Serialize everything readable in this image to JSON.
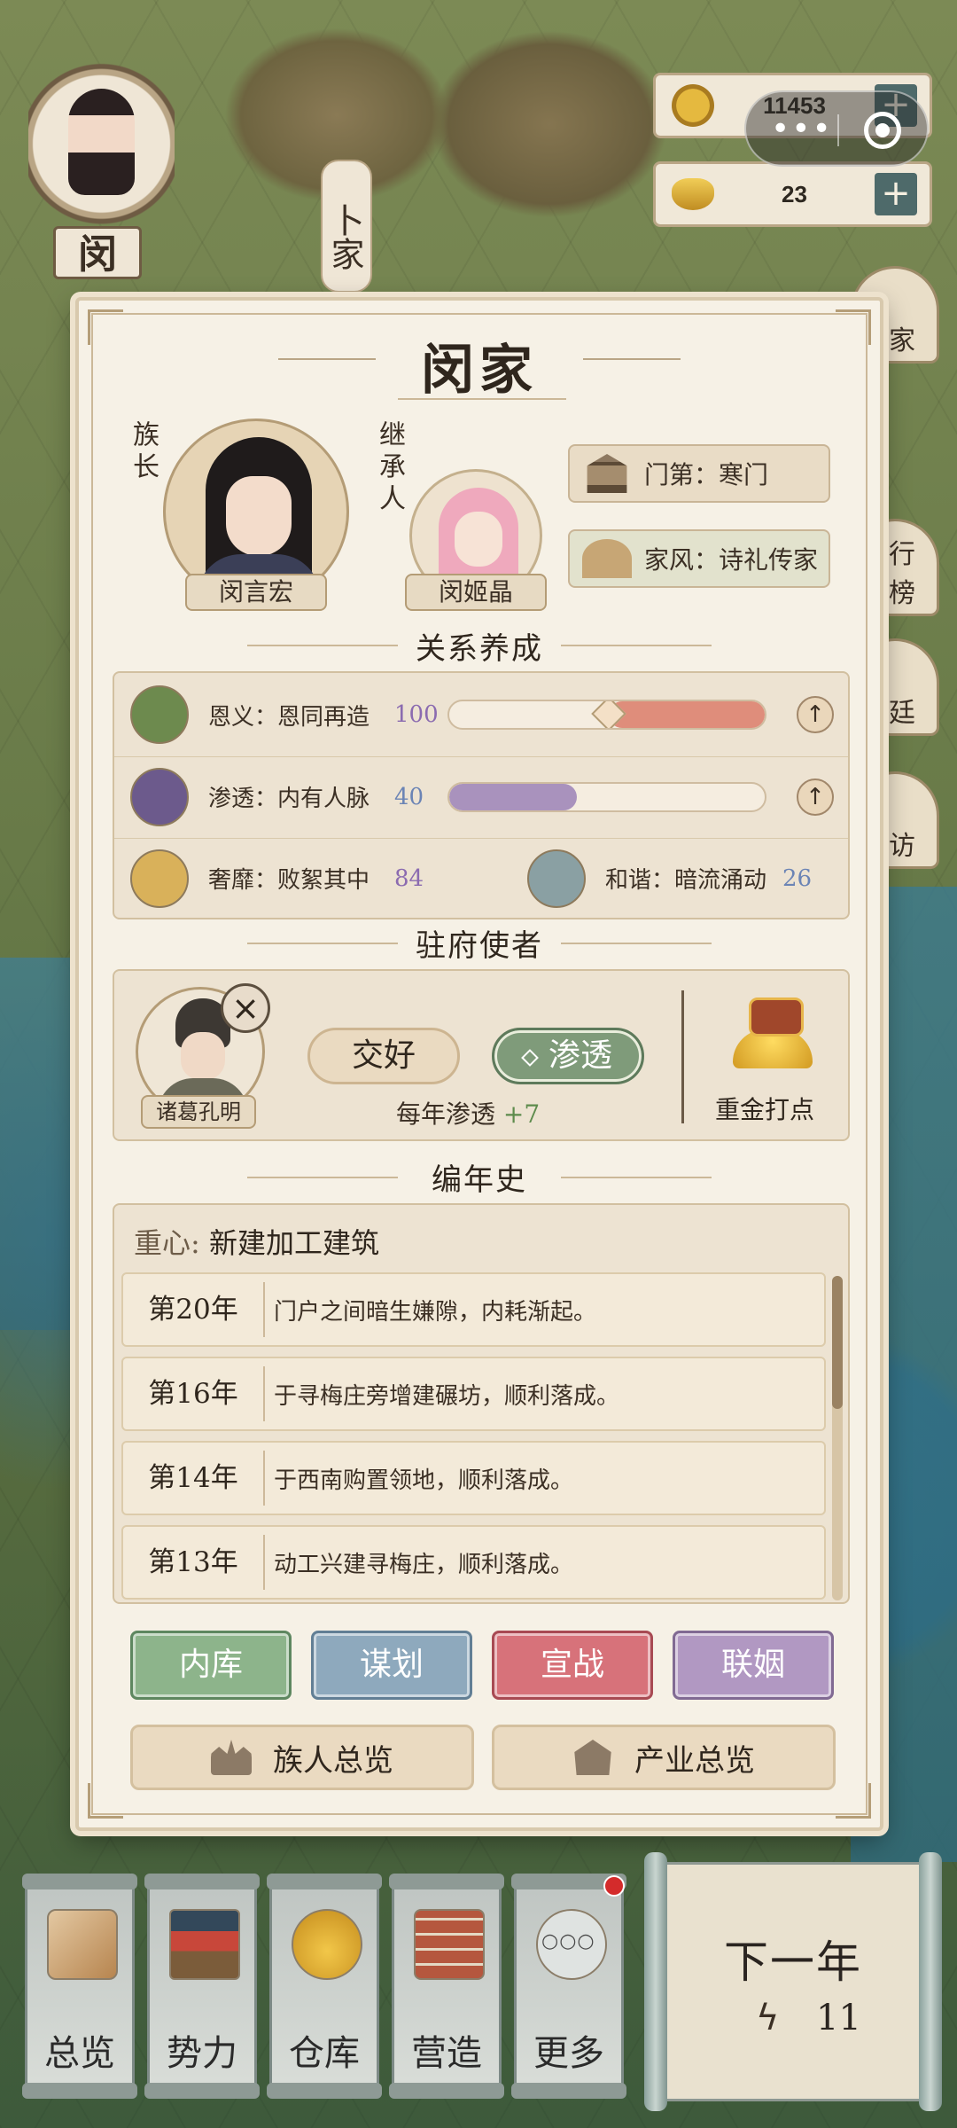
{
  "map": {
    "lord_name": "闵",
    "map_label": "卜家",
    "side_buttons": [
      "家",
      "行榜",
      "廷",
      "访"
    ],
    "side_button_icons": [
      "location-icon",
      "trophy-icon",
      "palace-icon",
      "magnifier-icon"
    ]
  },
  "resources": [
    {
      "icon": "coin-icon",
      "value": "11453"
    },
    {
      "icon": "gold-ingot-icon",
      "value": "23"
    }
  ],
  "panel": {
    "title": "闵家",
    "head_label": "族长",
    "heir_label": "继承人",
    "head_name": "闵言宏",
    "heir_name": "闵姬晶",
    "status_tag": "门第：寒门",
    "custom_tag": "家风：诗礼传家"
  },
  "relations": {
    "header": "关系养成",
    "rows": [
      {
        "label": "恩义：恩同再造",
        "value": "100",
        "value_color": "#8b6bb0",
        "bar_fill": 0.5,
        "bar_color": "#df8d7b",
        "icon": "handshake-icon"
      },
      {
        "label": "渗透：内有人脉",
        "value": "40",
        "value_color": "#6b84b5",
        "bar_fill": 0.4,
        "bar_color": "#a992bd",
        "icon": "ninja-icon"
      }
    ],
    "luxury": {
      "label": "奢靡：败絮其中",
      "value": "84",
      "value_color": "#8b6bb0",
      "icon": "gold-pile-icon"
    },
    "harmony": {
      "label": "和谐：暗流涌动",
      "value": "26",
      "value_color": "#6b84b5",
      "icon": "lotus-icon"
    }
  },
  "envoy": {
    "header": "驻府使者",
    "name": "诸葛孔明",
    "btn_friendly": "交好",
    "btn_infiltrate": "渗透",
    "note_prefix": "每年渗透",
    "note_value": "+7",
    "bribe_label": "重金打点"
  },
  "chronicle": {
    "header": "编年史",
    "focus_key": "重心:",
    "focus_value": "新建加工建筑",
    "entries": [
      {
        "year": "第20年",
        "text": "门户之间暗生嫌隙，内耗渐起。"
      },
      {
        "year": "第16年",
        "text": "于寻梅庄旁增建碾坊，顺利落成。"
      },
      {
        "year": "第14年",
        "text": "于西南购置领地，顺利落成。"
      },
      {
        "year": "第13年",
        "text": "动工兴建寻梅庄，顺利落成。"
      }
    ]
  },
  "actions": {
    "treasury": "内库",
    "plan": "谋划",
    "war": "宣战",
    "marriage": "联姻",
    "members": "族人总览",
    "industry": "产业总览"
  },
  "nav": {
    "items": [
      {
        "label": "总览",
        "icon": "scroll-brush-icon"
      },
      {
        "label": "势力",
        "icon": "temple-icon"
      },
      {
        "label": "仓库",
        "icon": "money-bag-icon"
      },
      {
        "label": "营造",
        "icon": "bricks-trowel-icon"
      },
      {
        "label": "更多",
        "icon": "more-icon"
      }
    ],
    "next_year": "下一年",
    "energy": "11"
  }
}
